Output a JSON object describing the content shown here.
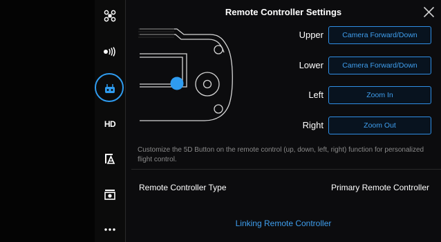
{
  "title": "Remote Controller Settings",
  "sidebar": {
    "items": [
      {
        "name": "aircraft",
        "icon": "drone-icon"
      },
      {
        "name": "signal",
        "icon": "signal-icon"
      },
      {
        "name": "remote-controller",
        "icon": "remote-controller-icon",
        "active": true
      },
      {
        "name": "hd",
        "label": "HD"
      },
      {
        "name": "gimbal",
        "icon": "gimbal-icon"
      },
      {
        "name": "camera",
        "icon": "camera-icon"
      },
      {
        "name": "more",
        "icon": "more-icon"
      }
    ]
  },
  "functions": [
    {
      "label": "Upper",
      "value": "Camera Forward/Down"
    },
    {
      "label": "Lower",
      "value": "Camera Forward/Down"
    },
    {
      "label": "Left",
      "value": "Zoom In"
    },
    {
      "label": "Right",
      "value": "Zoom Out"
    }
  ],
  "description": "Customize the 5D Button on the remote control (up, down, left, right) function for personalized flight control.",
  "rc_type": {
    "label": "Remote Controller Type",
    "value": "Primary Remote Controller"
  },
  "link_label": "Linking Remote Controller",
  "colors": {
    "accent": "#2f9cf0",
    "background": "#0c0c0e"
  }
}
